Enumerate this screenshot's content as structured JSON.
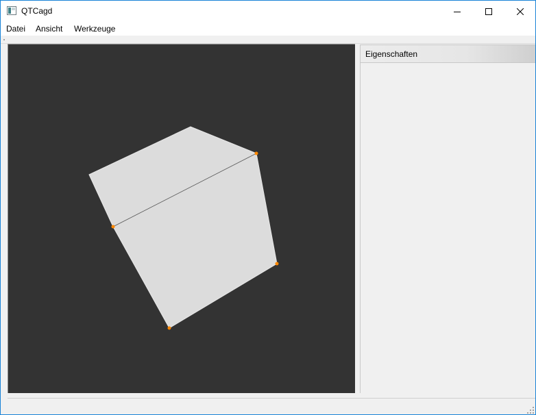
{
  "window": {
    "title": "QTCagd"
  },
  "menu": {
    "items": [
      "Datei",
      "Ansicht",
      "Werkzeuge"
    ]
  },
  "dock": {
    "title": "Eigenschaften"
  },
  "colors": {
    "viewport_bg": "#333333",
    "surface": "#dcdcdc",
    "control_point": "#ff8800"
  },
  "icons": {
    "app": "app-icon",
    "minimize": "minimize-icon",
    "maximize": "maximize-icon",
    "close": "close-icon",
    "size_grip": "size-grip-icon"
  }
}
